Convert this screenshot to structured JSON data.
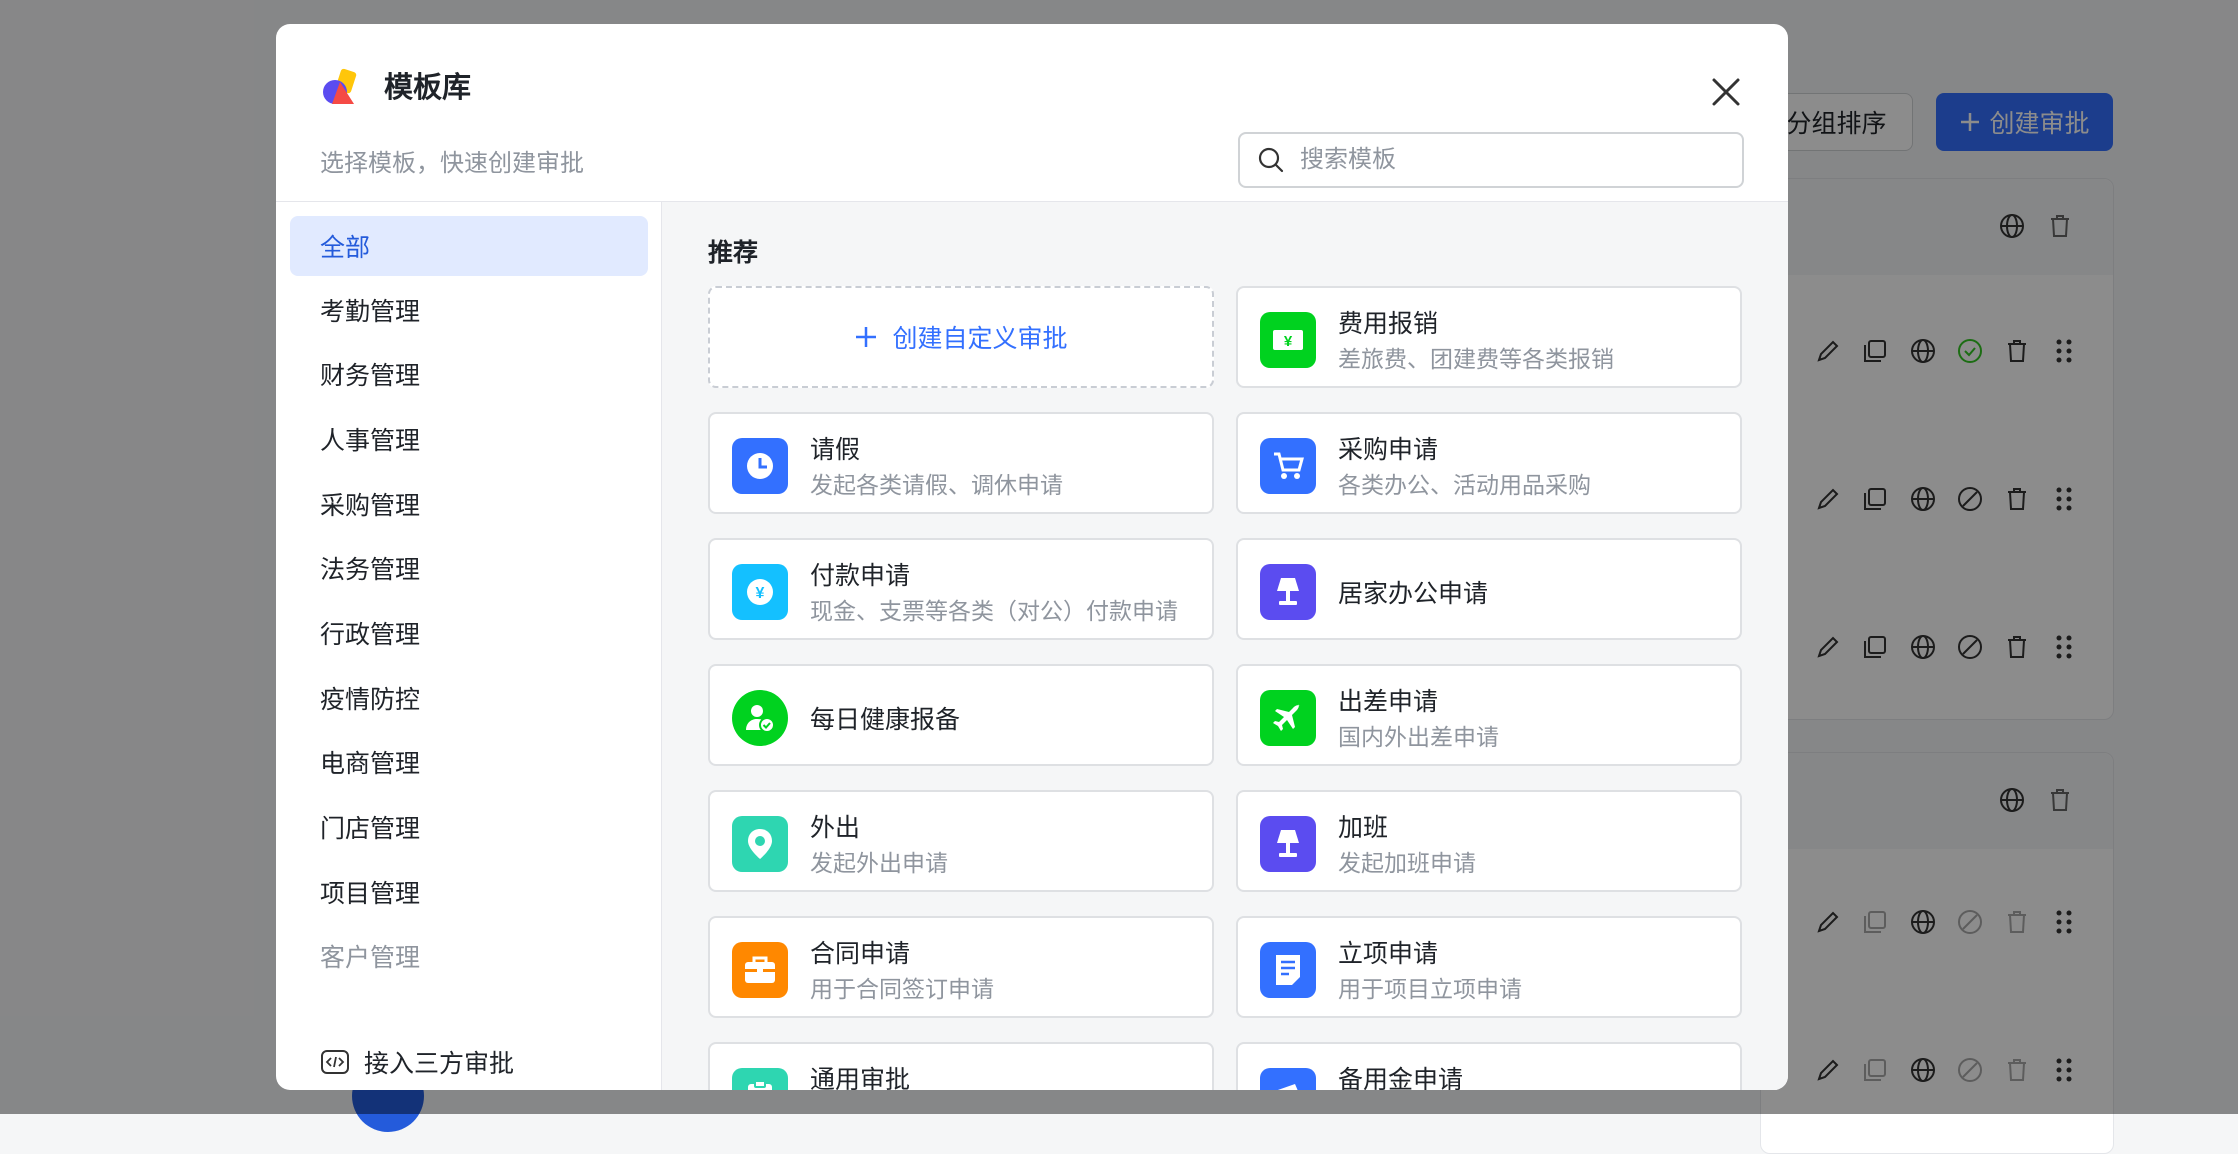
{
  "background": {
    "sort_label": "分组排序",
    "create_label": "创建审批",
    "colors": {
      "primary": "#3370ff",
      "success": "#34c724"
    }
  },
  "modal": {
    "title": "模板库",
    "subtitle": "选择模板，快速创建审批",
    "search_placeholder": "搜索模板",
    "categories": [
      {
        "label": "全部",
        "active": true
      },
      {
        "label": "考勤管理"
      },
      {
        "label": "财务管理"
      },
      {
        "label": "人事管理"
      },
      {
        "label": "采购管理"
      },
      {
        "label": "法务管理"
      },
      {
        "label": "行政管理"
      },
      {
        "label": "疫情防控"
      },
      {
        "label": "电商管理"
      },
      {
        "label": "门店管理"
      },
      {
        "label": "项目管理"
      },
      {
        "label": "客户管理"
      }
    ],
    "third_party_label": "接入三方审批",
    "section_title": "推荐",
    "custom_create_label": "创建自定义审批",
    "templates": [
      {
        "name": "费用报销",
        "desc": "差旅费、团建费等各类报销",
        "icon": "yen-receipt-icon",
        "color": "#00d21f"
      },
      {
        "name": "请假",
        "desc": "发起各类请假、调休申请",
        "icon": "clock-icon",
        "color": "#3370ff"
      },
      {
        "name": "采购申请",
        "desc": "各类办公、活动用品采购",
        "icon": "cart-icon",
        "color": "#3370ff"
      },
      {
        "name": "付款申请",
        "desc": "现金、支票等各类（对公）付款申请",
        "icon": "yen-coin-icon",
        "color": "#14c0ff"
      },
      {
        "name": "居家办公申请",
        "desc": "",
        "icon": "lamp-icon",
        "color": "#5b4cf0"
      },
      {
        "name": "每日健康报备",
        "desc": "",
        "icon": "user-check-icon",
        "color": "#00d21f"
      },
      {
        "name": "出差申请",
        "desc": "国内外出差申请",
        "icon": "plane-icon",
        "color": "#00d21f"
      },
      {
        "name": "外出",
        "desc": "发起外出申请",
        "icon": "location-pin-icon",
        "color": "#2ed6b1"
      },
      {
        "name": "加班",
        "desc": "发起加班申请",
        "icon": "lamp-icon",
        "color": "#5b4cf0"
      },
      {
        "name": "合同申请",
        "desc": "用于合同签订申请",
        "icon": "briefcase-icon",
        "color": "#ff8800"
      },
      {
        "name": "立项申请",
        "desc": "用于项目立项申请",
        "icon": "document-icon",
        "color": "#3370ff"
      },
      {
        "name": "通用审批",
        "desc": "",
        "icon": "clipboard-icon",
        "color": "#2ed6b1"
      },
      {
        "name": "备用金申请",
        "desc": "",
        "icon": "wallet-icon",
        "color": "#3370ff"
      }
    ]
  }
}
